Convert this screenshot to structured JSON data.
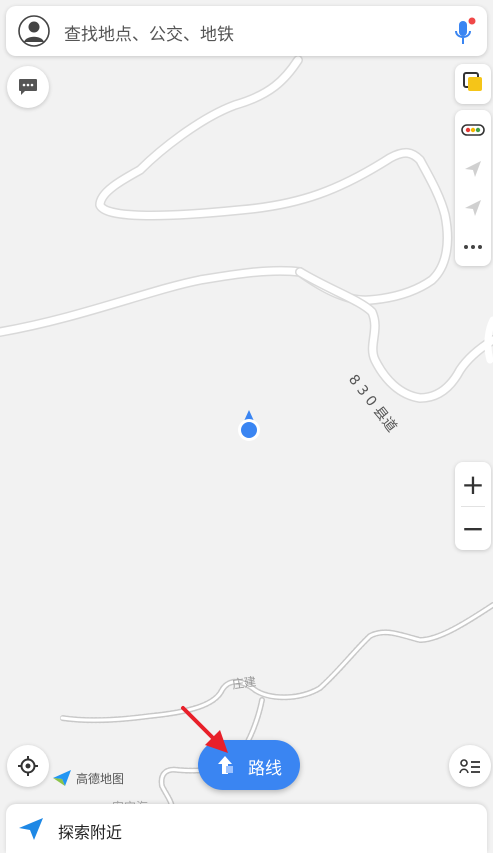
{
  "search": {
    "placeholder": "查找地点、公交、地铁"
  },
  "map": {
    "road_label": "8 3 0 县道",
    "trail_label_1": "庄建",
    "trail_label_2": "安宝海"
  },
  "zoom": {
    "in_label": "+",
    "out_label": "−"
  },
  "logo": {
    "text": "高德地图"
  },
  "route_button": {
    "label": "路线"
  },
  "bottom_bar": {
    "label": "探索附近"
  },
  "colors": {
    "accent": "#3a85f2",
    "annotation_arrow": "#e8202a"
  },
  "icons": [
    "user-avatar-icon",
    "microphone-icon",
    "message-icon",
    "layers-icon",
    "traffic-icon",
    "send-icon",
    "more-icon",
    "locate-icon",
    "list-icon",
    "navigate-icon"
  ]
}
